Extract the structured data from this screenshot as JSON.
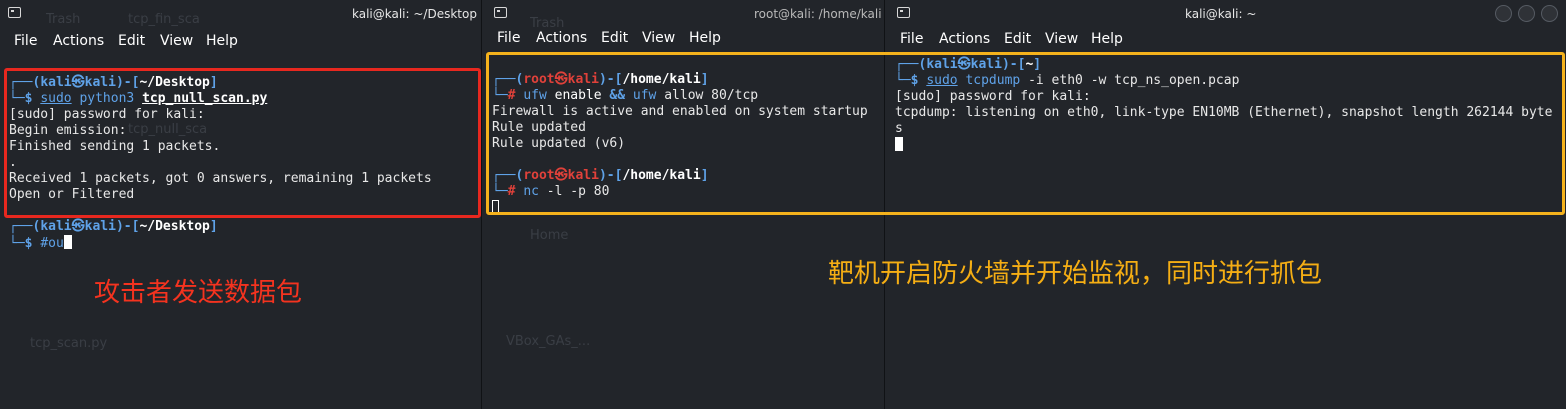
{
  "menu": [
    "File",
    "Actions",
    "Edit",
    "View",
    "Help"
  ],
  "terminals": {
    "left": {
      "title": "kali@kali: ~/Desktop",
      "lines": {
        "p1_user": "kali",
        "p1_at": "㉿",
        "p1_host": "kali",
        "p1_path": "~/Desktop",
        "c1_sudo": "sudo",
        "c1_prog": "python3",
        "c1_arg": "tcp_null_scan.py",
        "o1": "[sudo] password for kali:",
        "o2": "Begin emission:",
        "o3": "Finished sending 1 packets.",
        "o4": ".",
        "o5": "Received 1 packets, got 0 answers, remaining 1 packets",
        "o6": "Open or Filtered",
        "p2_user": "kali",
        "p2_at": "㉿",
        "p2_host": "kali",
        "p2_path": "~/Desktop",
        "c2": "#ou"
      },
      "ghost": {
        "g1": "Trash",
        "g2": "tcp_fin_sca",
        "g3": "tcp_null_sca",
        "g4": "tcp_scan.py"
      }
    },
    "middle": {
      "title": "root@kali: /home/kali",
      "lines": {
        "p1_user": "root",
        "p1_at": "㉿",
        "p1_host": "kali",
        "p1_path": "/home/kali",
        "c1a": "ufw",
        "c1b": "enable",
        "c1c": "&&",
        "c1d": "ufw",
        "c1e": "allow 80/tcp",
        "o1": "Firewall is active and enabled on system startup",
        "o2": "Rule updated",
        "o3": "Rule updated (v6)",
        "p2_user": "root",
        "p2_at": "㉿",
        "p2_host": "kali",
        "p2_path": "/home/kali",
        "c2a": "nc",
        "c2b": "-l -p 80"
      },
      "ghost": {
        "g1": "Trash",
        "g2": "Home",
        "g3": "VBox_GAs_..."
      }
    },
    "right": {
      "title": "kali@kali: ~",
      "lines": {
        "p1_user": "kali",
        "p1_at": "㉿",
        "p1_host": "kali",
        "p1_path": "~",
        "c1_sudo": "sudo",
        "c1_prog": "tcpdump",
        "c1_args": "-i eth0 -w tcp_ns_open.pcap",
        "o1": "[sudo] password for kali:",
        "o2": "tcpdump: listening on eth0, link-type EN10MB (Ethernet), snapshot length 262144 byte",
        "o3": "s"
      }
    }
  },
  "annotations": {
    "attacker": "攻击者发送数据包",
    "target": "靶机开启防火墙并开始监视，同时进行抓包"
  },
  "colors": {
    "attacker_box": "#e8281f",
    "target_box": "#f5b21c",
    "attacker_text": "#f4331f",
    "target_text": "#f5ae14"
  }
}
